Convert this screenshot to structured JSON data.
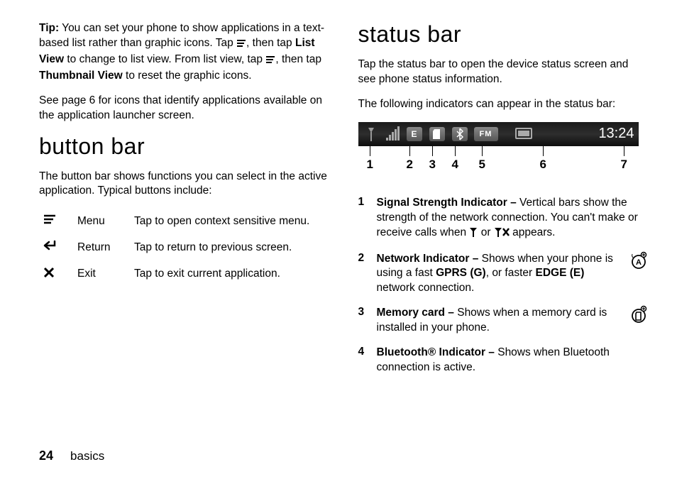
{
  "tip": {
    "label": "Tip:",
    "text1": " You can set your phone to show applications in a text-based list rather than graphic icons. Tap ",
    "text2": ", then tap ",
    "listview": "List View",
    "text3": " to change to list view. From list view, tap ",
    "text4": ", then tap ",
    "thumbnail": "Thumbnail View",
    "text5": " to reset the graphic icons."
  },
  "see_page": "See page 6 for icons that identify applications available on the application launcher screen.",
  "button_bar": {
    "heading": "button bar",
    "intro": "The button bar shows functions you can select in the active application. Typical buttons include:",
    "rows": [
      {
        "name": "Menu",
        "desc": "Tap to open context sensitive menu."
      },
      {
        "name": "Return",
        "desc": "Tap to return to previous screen."
      },
      {
        "name": "Exit",
        "desc": "Tap to exit current application."
      }
    ]
  },
  "status_bar": {
    "heading": "status bar",
    "intro": "Tap the status bar to open the device status screen and see phone status information.",
    "lead": "The following indicators can appear in the status bar:",
    "fm_label": "FM",
    "time": "13:24",
    "callouts": [
      "1",
      "2",
      "3",
      "4",
      "5",
      "6",
      "7"
    ],
    "items": [
      {
        "n": "1",
        "title": "Signal Strength Indicator –",
        "body1": " Vertical bars show the strength of the network connection. You can't make or receive calls when ",
        "body2": " or ",
        "body3": " appears."
      },
      {
        "n": "2",
        "title": "Network Indicator –",
        "body": " Shows when your phone is using a fast ",
        "gprs": "GPRS",
        "g": " (G)",
        "mid": ", or faster ",
        "edge": "EDGE",
        "e": " (E)",
        "tail": " network connection."
      },
      {
        "n": "3",
        "title": "Memory card –",
        "body": " Shows when a memory card is installed in your phone."
      },
      {
        "n": "4",
        "title": "Bluetooth® Indicator –",
        "body": " Shows when Bluetooth connection is active."
      }
    ]
  },
  "footer": {
    "page": "24",
    "section": "basics"
  }
}
